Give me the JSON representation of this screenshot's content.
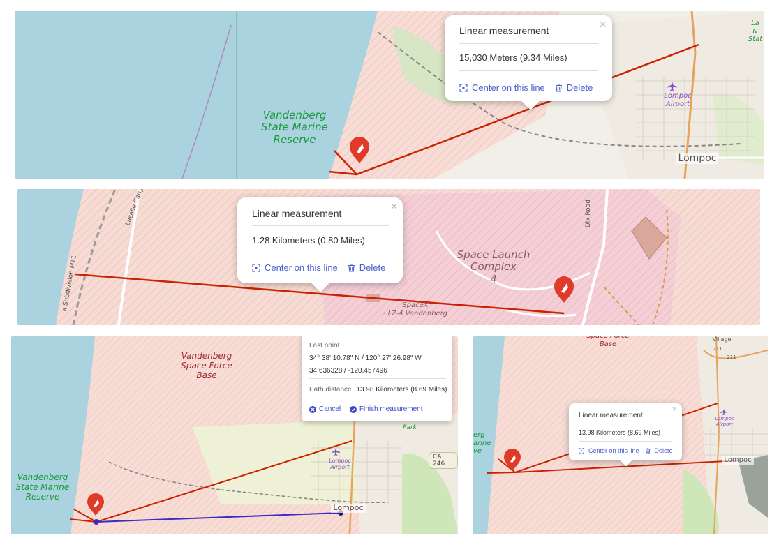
{
  "colors": {
    "water": "#aad3df",
    "land": "#f2efe9",
    "military_hatch": "#f5d6d0",
    "measure_line": "#cc2200",
    "measure_line_active": "#3a2bc4",
    "accent": "#4a5fd0",
    "marker": "#e03a2b"
  },
  "panel1": {
    "popup": {
      "title": "Linear measurement",
      "distance": "15,030 Meters (9.34 Miles)",
      "center_label": "Center on this line",
      "delete_label": "Delete",
      "close": "×"
    },
    "labels": {
      "reserve": "Vandenberg\nState Marine\nReserve",
      "airport": "Lompoc\nAirport",
      "city": "Lompoc",
      "corner": "La\nN\nStat"
    }
  },
  "panel2": {
    "popup": {
      "title": "Linear measurement",
      "distance": "1.28 Kilometers (0.80 Miles)",
      "center_label": "Center on this line",
      "delete_label": "Delete",
      "close": "×"
    },
    "labels": {
      "complex": "Space Launch\nComplex\n4",
      "spacex": "SpaceX\n- LZ-4 Vandenberg",
      "dix_road": "Dix Road",
      "lasalle": "Lasalle Cany",
      "subdivision": "a Subdivision MT1"
    }
  },
  "panel3": {
    "measure": {
      "last_point_label": "Last point",
      "dms": "34° 38' 10.78\" N / 120° 27' 26.98\" W",
      "decimal": "34.636328 / -120.457496",
      "path_label": "Path distance",
      "path_value": "13.98 Kilometers (8.69 Miles)",
      "cancel_label": "Cancel",
      "finish_label": "Finish measurement"
    },
    "labels": {
      "base": "Vandenberg\nSpace Force\nBase",
      "reserve": "Vandenberg\nState Marine\nReserve",
      "airport": "Lompoc\nAirport",
      "city": "Lompoc",
      "park": "Park",
      "highway": "CA 246"
    }
  },
  "panel4": {
    "popup": {
      "title": "Linear measurement",
      "distance": "13.98 Kilometers (8.69 Miles)",
      "center_label": "Center on this line",
      "delete_label": "Delete",
      "close": "×"
    },
    "labels": {
      "base": "Space Force\nBase",
      "village": "Village",
      "road_a": "211",
      "road_b": "211",
      "reserve": "erg\narine\nve",
      "airport": "Lompoc\nAirport",
      "city": "Lompoc"
    }
  }
}
